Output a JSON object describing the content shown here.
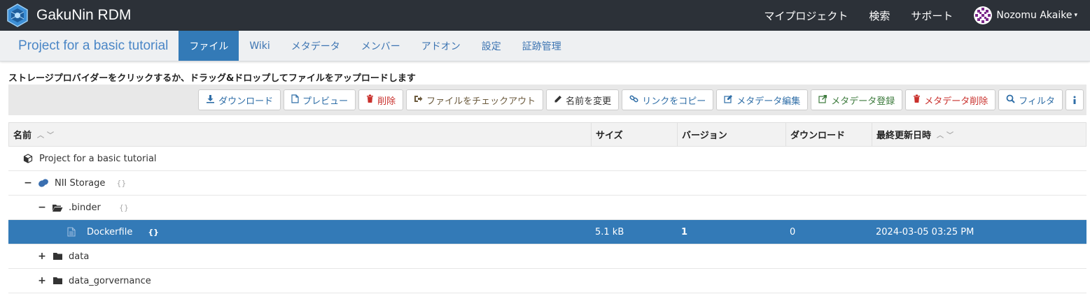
{
  "app": {
    "name": "GakuNin RDM",
    "logo_icon": "gakunin-rdm-logo-icon"
  },
  "topnav": {
    "links": [
      "マイプロジェクト",
      "検索",
      "サポート"
    ],
    "user_name": "Nozomu Akaike",
    "user_caret": "▾"
  },
  "project": {
    "title": "Project for a basic tutorial",
    "tabs": [
      "ファイル",
      "Wiki",
      "メタデータ",
      "メンバー",
      "アドオン",
      "設定",
      "証跡管理"
    ],
    "active_tab": "ファイル"
  },
  "instruction": "ストレージプロバイダーをクリックするか、ドラッグ&ドロップしてファイルをアップロードします",
  "toolbar": {
    "download": "ダウンロード",
    "preview": "プレビュー",
    "delete": "削除",
    "checkout": "ファイルをチェックアウト",
    "rename": "名前を変更",
    "copy_link": "リンクをコピー",
    "edit_metadata": "メタデータ編集",
    "register_metadata": "メタデータ登録",
    "delete_metadata": "メタデータ削除",
    "filter": "フィルタ",
    "info_icon": "info-icon"
  },
  "grid": {
    "columns": {
      "name": "名前",
      "size": "サイズ",
      "version": "バージョン",
      "downloads": "ダウンロード",
      "modified": "最終更新日時"
    },
    "rows": [
      {
        "level": 0,
        "toggle": "",
        "icon": "cube-icon",
        "name": "Project for a basic tutorial",
        "meta": "",
        "size": "",
        "version": "",
        "downloads": "",
        "modified": "",
        "selected": false
      },
      {
        "level": 1,
        "toggle": "−",
        "icon": "nii-storage-icon",
        "name": "NII Storage",
        "meta": "{}",
        "size": "",
        "version": "",
        "downloads": "",
        "modified": "",
        "selected": false
      },
      {
        "level": 2,
        "toggle": "−",
        "icon": "folder-open-icon",
        "name": ".binder",
        "meta": "{}",
        "size": "",
        "version": "",
        "downloads": "",
        "modified": "",
        "selected": false
      },
      {
        "level": 3,
        "toggle": "",
        "icon": "file-icon",
        "name": "Dockerfile",
        "meta": "{}",
        "size": "5.1 kB",
        "version": "1",
        "downloads": "0",
        "modified": "2024-03-05 03:25 PM",
        "selected": true
      },
      {
        "level": 2,
        "toggle": "+",
        "icon": "folder-icon",
        "name": "data",
        "meta": "",
        "size": "",
        "version": "",
        "downloads": "",
        "modified": "",
        "selected": false
      },
      {
        "level": 2,
        "toggle": "+",
        "icon": "folder-icon",
        "name": "data_gorvernance",
        "meta": "",
        "size": "",
        "version": "",
        "downloads": "",
        "modified": "",
        "selected": false
      }
    ]
  },
  "colors": {
    "topnav_bg": "#2c3138",
    "accent": "#337ab7",
    "project_title": "#4a86c6"
  }
}
